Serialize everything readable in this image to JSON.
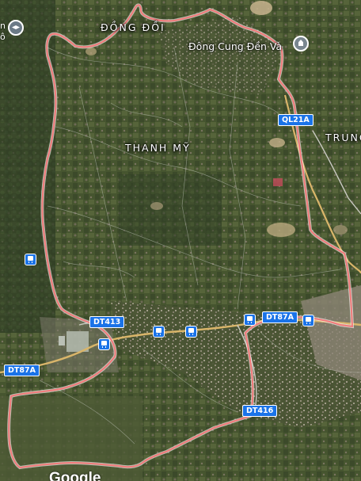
{
  "places": {
    "dong_doi": "ĐỒNG ĐỒI",
    "thanh_my": "THANH MỸ",
    "trung": "TRUNG"
  },
  "pois": {
    "temple": "Đông Cung Đền Và"
  },
  "roads": {
    "ql21a": "QL21A",
    "dt413": "DT413",
    "dt87a_east": "DT87A",
    "dt87a_west": "DT87A",
    "dt416": "DT416"
  },
  "edge_left": "n",
  "edge_left2": "ô",
  "watermark": "Google",
  "colors": {
    "boundary": "#f27a7a",
    "road_major": "#d9b56a",
    "road_minor": "#c8c8c0",
    "shield": "#1a73e8"
  },
  "icons": [
    "bus-stop-icon",
    "temple-icon",
    "school-icon"
  ]
}
